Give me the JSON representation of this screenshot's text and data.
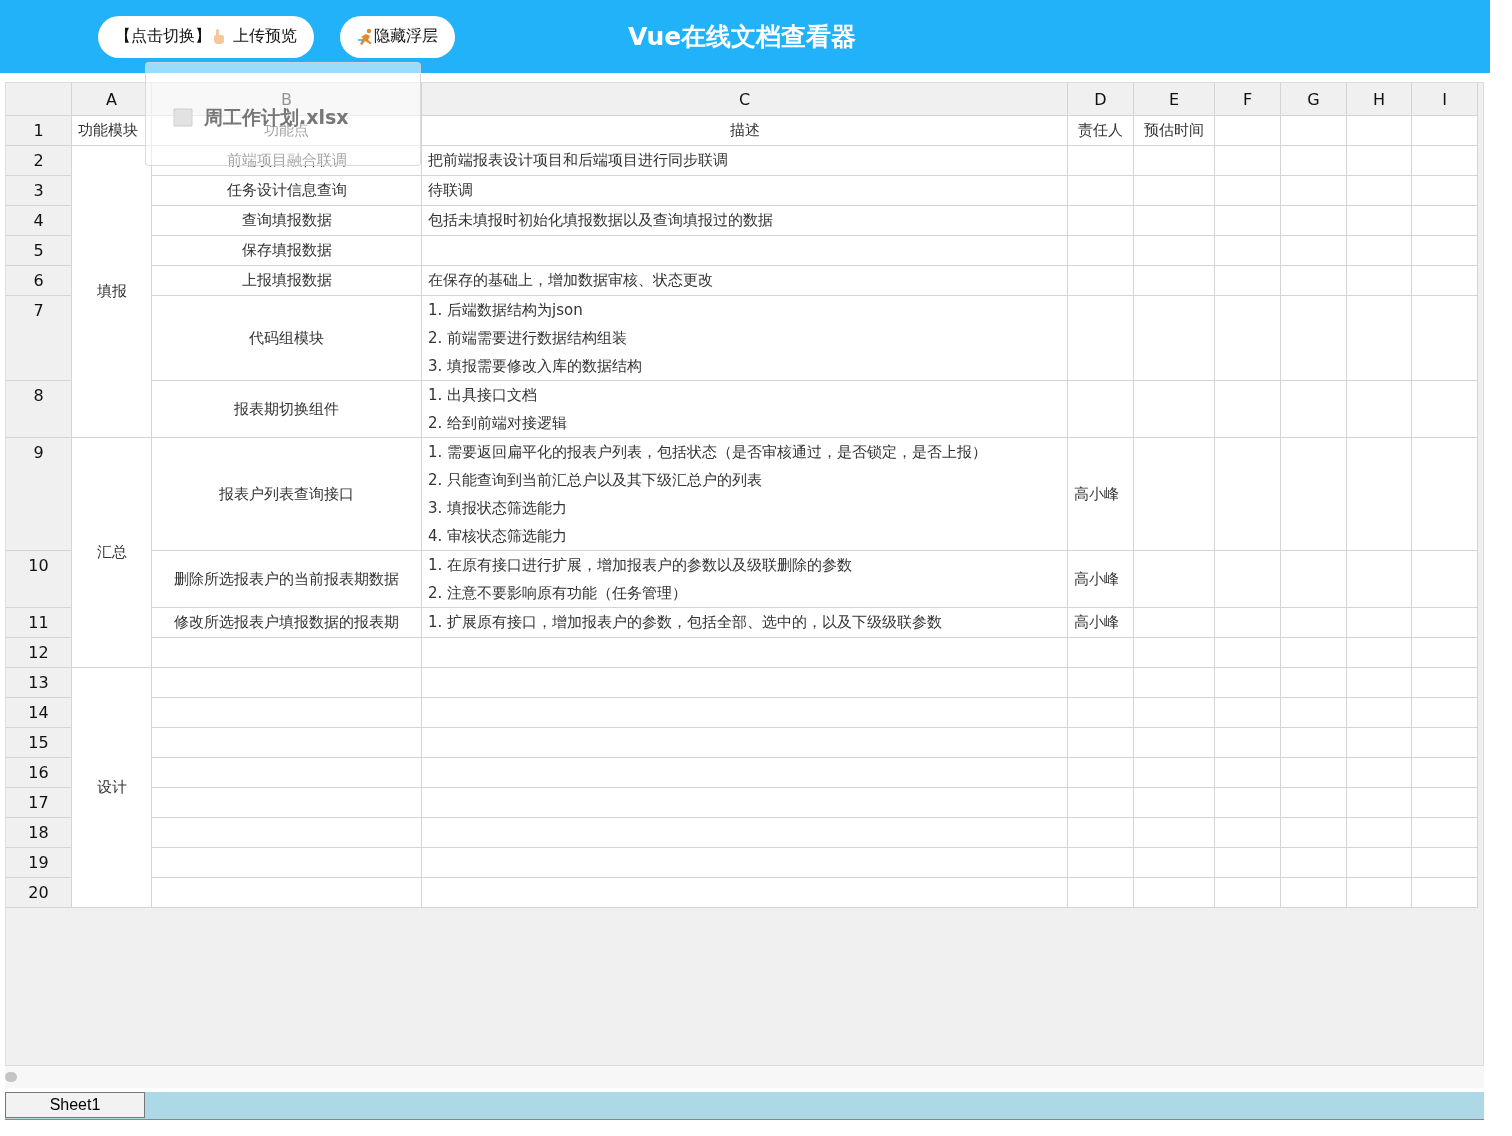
{
  "header": {
    "buttons": [
      {
        "kind": "switch",
        "parts": [
          "【点击切换】",
          "上传预览"
        ]
      },
      {
        "kind": "hide",
        "parts": [
          "隐藏浮层"
        ]
      }
    ],
    "title": "Vue在线文档查看器"
  },
  "overlay": {
    "file_name": "周工作计划.xlsx"
  },
  "sheet": {
    "columns": [
      "A",
      "B",
      "C",
      "D",
      "E",
      "F",
      "G",
      "H",
      "I"
    ],
    "header_row": {
      "number": "1",
      "cells": [
        "功能模块",
        "功能点",
        "描述",
        "责任人",
        "预估时间"
      ]
    },
    "groups": [
      {
        "label": "填报",
        "rows": [
          {
            "number": "2",
            "feature": "前端项目融合联调",
            "description": [
              "把前端报表设计项目和后端项目进行同步联调"
            ]
          },
          {
            "number": "3",
            "feature": "任务设计信息查询",
            "description": [
              "待联调"
            ]
          },
          {
            "number": "4",
            "feature": "查询填报数据",
            "description": [
              "包括未填报时初始化填报数据以及查询填报过的数据"
            ]
          },
          {
            "number": "5",
            "feature": "保存填报数据"
          },
          {
            "number": "6",
            "feature": "上报填报数据",
            "description": [
              "在保存的基础上，增加数据审核、状态更改"
            ]
          },
          {
            "number": "7",
            "feature": "代码组模块",
            "description": [
              "1. 后端数据结构为json",
              "2. 前端需要进行数据结构组装",
              "3. 填报需要修改入库的数据结构"
            ]
          },
          {
            "number": "8",
            "feature": "报表期切换组件",
            "description": [
              "1. 出具接口文档",
              "2. 给到前端对接逻辑"
            ]
          }
        ]
      },
      {
        "label": "汇总",
        "rows": [
          {
            "number": "9",
            "feature": "报表户列表查询接口",
            "description": [
              "1. 需要返回扁平化的报表户列表，包括状态（是否审核通过，是否锁定，是否上报）",
              "2. 只能查询到当前汇总户以及其下级汇总户的列表",
              "3. 填报状态筛选能力",
              "4. 审核状态筛选能力"
            ],
            "owner": "高小峰"
          },
          {
            "number": "10",
            "feature": "删除所选报表户的当前报表期数据",
            "description": [
              "1. 在原有接口进行扩展，增加报表户的参数以及级联删除的参数",
              "2. 注意不要影响原有功能（任务管理）"
            ],
            "owner": "高小峰"
          },
          {
            "number": "11",
            "feature": "修改所选报表户填报数据的报表期",
            "description": [
              "1. 扩展原有接口，增加报表户的参数，包括全部、选中的，以及下级级联参数"
            ],
            "owner": "高小峰"
          },
          {
            "number": "12"
          }
        ]
      },
      {
        "label": "设计",
        "rows": [
          {
            "number": "13"
          },
          {
            "number": "14"
          },
          {
            "number": "15"
          },
          {
            "number": "16"
          },
          {
            "number": "17"
          },
          {
            "number": "18"
          },
          {
            "number": "19"
          },
          {
            "number": "20"
          }
        ]
      }
    ]
  },
  "sheet_tabs": [
    {
      "label": "Sheet1",
      "selected": true
    }
  ]
}
